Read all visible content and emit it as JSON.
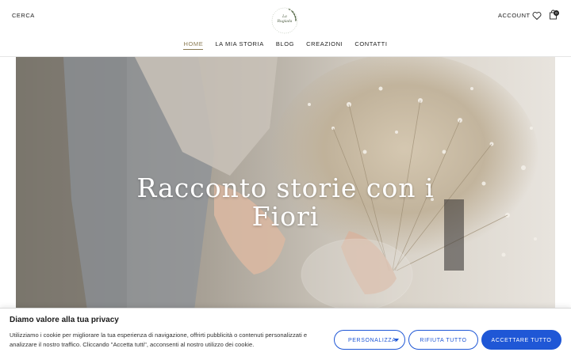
{
  "header": {
    "search_label": "CERCA",
    "logo_text_line1": "La",
    "logo_text_line2": "Rugiada",
    "account_label": "ACCOUNT",
    "cart_count": "0"
  },
  "nav": {
    "items": [
      {
        "label": "HOME",
        "active": true
      },
      {
        "label": "LA MIA STORIA",
        "active": false
      },
      {
        "label": "BLOG",
        "active": false
      },
      {
        "label": "CREAZIONI",
        "active": false
      },
      {
        "label": "CONTATTI",
        "active": false
      }
    ]
  },
  "hero": {
    "title_line1": "Racconto storie con i",
    "title_line2": "Fiori"
  },
  "cookie": {
    "title": "Diamo valore alla tua privacy",
    "text": "Utilizziamo i cookie per migliorare la tua esperienza di navigazione, offrirti pubblicità o contenuti personalizzati e analizzare il nostro traffico. Cliccando \"Accetta tutti\", acconsenti al nostro utilizzo dei cookie.",
    "customize_label": "PERSONALIZZA",
    "reject_label": "RIFIUTA TUTTO",
    "accept_label": "ACCETTARE TUTTO"
  },
  "colors": {
    "accent": "#1f57d6",
    "nav_active": "#8a7a52",
    "logo_green": "#4a5a3e"
  },
  "icons": {
    "wishlist": "heart-icon",
    "cart": "shopping-bag-icon",
    "customize_dropdown": "caret-down-icon"
  }
}
